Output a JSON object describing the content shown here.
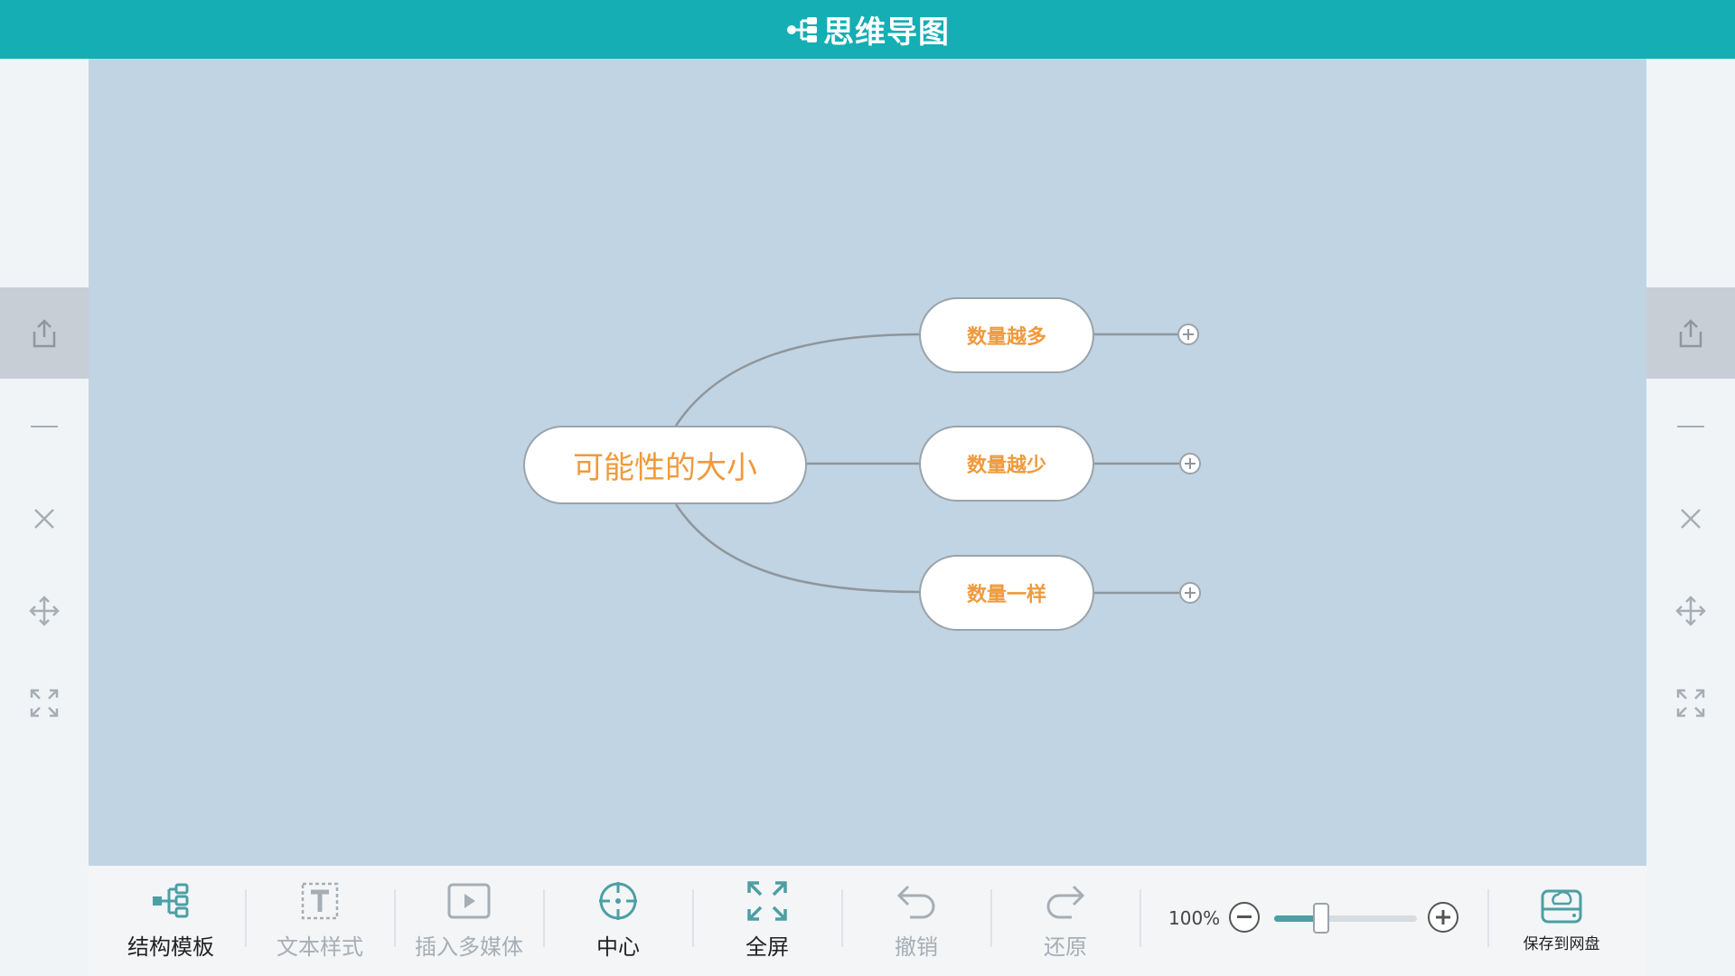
{
  "header": {
    "title": "思维导图"
  },
  "side_tools": [
    "export-icon",
    "minus-icon",
    "close-icon",
    "move-icon",
    "fit-icon"
  ],
  "mindmap": {
    "root": "可能性的大小",
    "children": [
      "数量越多",
      "数量越少",
      "数量一样"
    ]
  },
  "toolbar": {
    "template": "结构模板",
    "text_style": "文本样式",
    "media": "插入多媒体",
    "center": "中心",
    "fullscreen": "全屏",
    "undo": "撤销",
    "redo": "还原",
    "zoom": "100%",
    "zoom_level": 0.33,
    "save": "保存到网盘"
  },
  "colors": {
    "header": "#14aeb4",
    "canvas": "#c0d4e3",
    "node_text": "#ef9a3c",
    "accent": "#4c9fa3"
  }
}
